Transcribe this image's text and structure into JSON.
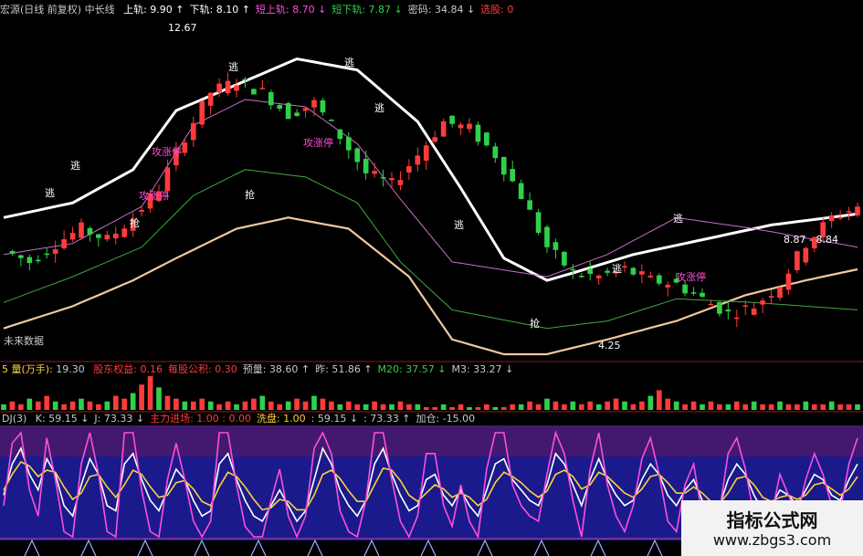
{
  "header": {
    "title": "宏源(日线 前复权) 中长线",
    "items": [
      {
        "label": "上轨:",
        "value": "9.90",
        "arrow": "↑",
        "color": "#ffffff"
      },
      {
        "label": "下轨:",
        "value": "8.10",
        "arrow": "↑",
        "color": "#ffffff"
      },
      {
        "label": "短上轨:",
        "value": "8.70",
        "arrow": "↓",
        "color": "#ff4fd8"
      },
      {
        "label": "短下轨:",
        "value": "7.87",
        "arrow": "↓",
        "color": "#2fd14a"
      },
      {
        "label": "密码:",
        "value": "34.84",
        "arrow": "↓",
        "color": "#c8c8c8"
      },
      {
        "label": "选股:",
        "value": "0",
        "arrow": "",
        "color": "#ff3b3b"
      }
    ]
  },
  "annotations": {
    "high_price": "12.67",
    "low_price": "4.25",
    "range_label": "8.87 - 8.84",
    "escape": "逃",
    "grab": "抢",
    "limit_up": "攻涨停",
    "future_data": "未来数据"
  },
  "volume_header": {
    "title": "5 量(万手):",
    "value": "19.30",
    "items": [
      {
        "label": "股东权益:",
        "value": "0.16",
        "color": "#ff3b3b"
      },
      {
        "label": "每股公积:",
        "value": "0.30",
        "color": "#ff3b3b"
      },
      {
        "label": "预量:",
        "value": "38.60",
        "arrow": "↑",
        "color": "#c8c8c8"
      },
      {
        "label": "昨:",
        "value": "51.86",
        "arrow": "↑",
        "color": "#c8c8c8"
      },
      {
        "label": "M20:",
        "value": "37.57",
        "arrow": "↓",
        "color": "#2fd14a"
      },
      {
        "label": "M3:",
        "value": "33.27",
        "arrow": "↓",
        "color": "#c8c8c8"
      }
    ]
  },
  "kdj_header": {
    "title": "DJ(3)",
    "items": [
      {
        "label": "K:",
        "value": "59.15",
        "arrow": "↓",
        "color": "#c8c8c8"
      },
      {
        "label": "J:",
        "value": "73.33",
        "arrow": "↓",
        "color": "#c8c8c8"
      },
      {
        "label": "主力进场:",
        "value": "1.00",
        "extra": "0.00",
        "color": "#ff3b3b"
      },
      {
        "label": "洗盘:",
        "value": "1.00",
        "extra": "",
        "color": "#ffd23a"
      },
      {
        "label": ":",
        "value": "59.15",
        "arrow": "↓",
        "color": "#c8c8c8"
      },
      {
        "label": ":",
        "value": "73.33",
        "arrow": "↑",
        "color": "#c8c8c8"
      },
      {
        "label": "加仓:",
        "value": "-15.00",
        "color": "#c8c8c8"
      }
    ]
  },
  "watermark": {
    "line1": "指标公式网",
    "line2": "www.zbgs3.com"
  },
  "colors": {
    "up": "#ff3b3b",
    "down": "#2fd14a",
    "upper_band": "#ffffff",
    "lower_band": "#f0c8a0",
    "short_upper": "#c86ec8",
    "short_lower": "#3fa83f",
    "kdj_bg": "#1a1a8c",
    "kdj_top": "#4a1a6a"
  },
  "chart_data": [
    {
      "type": "line",
      "panel": "price",
      "x_count": 100,
      "ylim": [
        3.8,
        13.0
      ],
      "price_points": [
        [
          0,
          6.7
        ],
        [
          3,
          6.4
        ],
        [
          6,
          6.9
        ],
        [
          9,
          7.3
        ],
        [
          12,
          7.0
        ],
        [
          15,
          7.6
        ],
        [
          18,
          8.4
        ],
        [
          21,
          9.8
        ],
        [
          24,
          11.0
        ],
        [
          27,
          11.3
        ],
        [
          30,
          11.0
        ],
        [
          33,
          10.4
        ],
        [
          36,
          10.7
        ],
        [
          39,
          9.8
        ],
        [
          42,
          8.8
        ],
        [
          45,
          8.5
        ],
        [
          48,
          9.3
        ],
        [
          51,
          10.2
        ],
        [
          54,
          10.0
        ],
        [
          57,
          9.3
        ],
        [
          60,
          8.2
        ],
        [
          63,
          6.8
        ],
        [
          66,
          6.1
        ],
        [
          69,
          6.0
        ],
        [
          72,
          6.2
        ],
        [
          75,
          5.9
        ],
        [
          78,
          5.8
        ],
        [
          81,
          5.4
        ],
        [
          84,
          5.0
        ],
        [
          87,
          5.2
        ],
        [
          90,
          5.8
        ],
        [
          93,
          6.9
        ],
        [
          96,
          7.6
        ],
        [
          99,
          7.9
        ]
      ],
      "upper_band": [
        [
          0,
          7.6
        ],
        [
          8,
          8.0
        ],
        [
          15,
          8.9
        ],
        [
          20,
          10.5
        ],
        [
          27,
          11.2
        ],
        [
          34,
          11.9
        ],
        [
          41,
          11.6
        ],
        [
          48,
          10.2
        ],
        [
          53,
          8.4
        ],
        [
          58,
          6.5
        ],
        [
          63,
          5.9
        ],
        [
          66,
          6.1
        ],
        [
          73,
          6.6
        ],
        [
          81,
          7.0
        ],
        [
          89,
          7.4
        ],
        [
          99,
          7.7
        ]
      ],
      "lower_band": [
        [
          0,
          4.6
        ],
        [
          8,
          5.2
        ],
        [
          15,
          5.9
        ],
        [
          20,
          6.5
        ],
        [
          27,
          7.3
        ],
        [
          33,
          7.6
        ],
        [
          40,
          7.3
        ],
        [
          47,
          6.0
        ],
        [
          52,
          4.3
        ],
        [
          58,
          3.9
        ],
        [
          63,
          3.9
        ],
        [
          70,
          4.3
        ],
        [
          78,
          4.8
        ],
        [
          86,
          5.5
        ],
        [
          93,
          5.9
        ],
        [
          99,
          6.2
        ]
      ],
      "short_upper": [
        [
          0,
          6.6
        ],
        [
          8,
          6.9
        ],
        [
          16,
          7.9
        ],
        [
          22,
          10.1
        ],
        [
          28,
          10.8
        ],
        [
          35,
          10.6
        ],
        [
          41,
          9.6
        ],
        [
          46,
          8.1
        ],
        [
          52,
          6.4
        ],
        [
          63,
          6.0
        ],
        [
          70,
          6.6
        ],
        [
          78,
          7.6
        ],
        [
          87,
          7.3
        ],
        [
          99,
          6.8
        ]
      ],
      "short_lower": [
        [
          0,
          5.3
        ],
        [
          8,
          6.0
        ],
        [
          16,
          6.8
        ],
        [
          22,
          8.2
        ],
        [
          28,
          8.9
        ],
        [
          35,
          8.7
        ],
        [
          41,
          8.0
        ],
        [
          46,
          6.4
        ],
        [
          52,
          5.1
        ],
        [
          63,
          4.6
        ],
        [
          70,
          4.8
        ],
        [
          78,
          5.4
        ],
        [
          87,
          5.3
        ],
        [
          99,
          5.1
        ]
      ]
    },
    {
      "type": "bar",
      "panel": "volume",
      "series": [
        {
          "values": [
            2,
            3,
            2,
            4,
            3,
            5,
            3,
            2,
            3,
            4,
            3,
            2,
            3,
            5,
            4,
            6,
            9,
            12,
            8,
            5,
            4,
            3,
            3,
            4,
            3,
            2,
            3,
            2,
            3,
            4,
            5,
            3,
            2,
            3,
            4,
            3,
            5,
            4,
            3,
            2,
            3,
            2,
            2,
            3,
            2,
            2,
            3,
            2,
            2,
            1,
            1,
            2,
            1,
            2,
            1,
            1,
            2,
            1,
            1,
            2,
            2,
            3,
            2,
            4,
            3,
            2,
            3,
            2,
            3,
            2,
            3,
            4,
            3,
            2,
            3,
            5,
            7,
            4,
            3,
            2,
            3,
            2,
            3,
            2,
            2,
            3,
            2,
            3,
            2,
            2,
            3,
            2,
            2,
            3,
            2,
            2,
            3,
            2,
            2,
            2
          ]
        }
      ]
    },
    {
      "type": "line",
      "panel": "kdj",
      "ylim": [
        0,
        100
      ],
      "series": [
        {
          "name": "K",
          "color": "#ffffff",
          "values": [
            40,
            70,
            85,
            60,
            45,
            75,
            60,
            30,
            20,
            50,
            75,
            60,
            30,
            25,
            70,
            80,
            55,
            35,
            25,
            45,
            65,
            55,
            35,
            20,
            25,
            70,
            80,
            55,
            35,
            20,
            15,
            30,
            45,
            30,
            15,
            25,
            55,
            85,
            70,
            45,
            30,
            20,
            35,
            70,
            85,
            60,
            40,
            25,
            30,
            55,
            60,
            40,
            30,
            45,
            30,
            20,
            45,
            70,
            75,
            55,
            45,
            35,
            30,
            50,
            80,
            70,
            50,
            30,
            55,
            75,
            55,
            40,
            30,
            35,
            55,
            70,
            60,
            40,
            30,
            45,
            55,
            35,
            25,
            30,
            55,
            70,
            60,
            40,
            25,
            30,
            45,
            40,
            30,
            45,
            60,
            55,
            40,
            35,
            55,
            70
          ]
        },
        {
          "name": "D",
          "color": "#ffd23a",
          "values": [
            45,
            60,
            72,
            68,
            58,
            64,
            62,
            48,
            36,
            42,
            58,
            60,
            48,
            38,
            50,
            64,
            60,
            48,
            38,
            40,
            52,
            54,
            46,
            34,
            30,
            48,
            62,
            58,
            48,
            36,
            26,
            28,
            36,
            34,
            26,
            26,
            40,
            60,
            64,
            56,
            44,
            34,
            34,
            50,
            66,
            64,
            54,
            40,
            34,
            42,
            50,
            46,
            38,
            42,
            38,
            30,
            36,
            52,
            62,
            58,
            52,
            44,
            38,
            44,
            60,
            64,
            58,
            46,
            50,
            62,
            58,
            50,
            42,
            38,
            46,
            58,
            60,
            52,
            42,
            42,
            48,
            42,
            34,
            32,
            42,
            56,
            58,
            50,
            38,
            34,
            38,
            40,
            36,
            40,
            50,
            52,
            46,
            40,
            46,
            58
          ]
        },
        {
          "name": "J",
          "color": "#ff4fd8",
          "values": [
            30,
            90,
            100,
            45,
            20,
            95,
            55,
            5,
            0,
            70,
            100,
            60,
            5,
            0,
            100,
            100,
            45,
            5,
            0,
            55,
            90,
            55,
            15,
            0,
            15,
            100,
            100,
            50,
            10,
            0,
            0,
            35,
            65,
            20,
            0,
            20,
            85,
            100,
            80,
            25,
            5,
            0,
            35,
            100,
            100,
            55,
            15,
            0,
            20,
            80,
            80,
            30,
            10,
            50,
            15,
            0,
            65,
            100,
            100,
            50,
            30,
            20,
            15,
            60,
            100,
            80,
            35,
            0,
            65,
            100,
            50,
            20,
            5,
            30,
            75,
            95,
            60,
            15,
            5,
            50,
            70,
            20,
            5,
            25,
            80,
            95,
            65,
            20,
            0,
            20,
            60,
            40,
            20,
            55,
            80,
            60,
            30,
            25,
            70,
            95
          ]
        }
      ]
    }
  ]
}
